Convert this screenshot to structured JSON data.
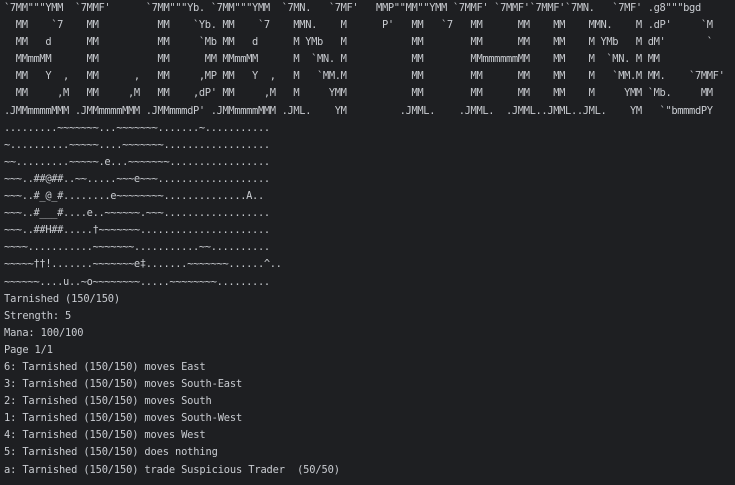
{
  "banner": [
    "`7MM\"\"\"YMM  `7MMF'      `7MM\"\"\"Yb. `7MM\"\"\"YMM  `7MN.   `7MF'   MMP\"\"MM\"\"YMM `7MMF' `7MMF'`7MMF'`7MN.   `7MF' .g8\"\"\"bgd",
    "  MM    `7    MM          MM    `Yb. MM    `7    MMN.    M      P'   MM   `7   MM      MM    MM    MMN.    M .dP'     `M",
    "  MM   d      MM          MM     `Mb MM   d      M YMb   M           MM        MM      MM    MM    M YMb   M dM'       `",
    "  MMmmMM      MM          MM      MM MMmmMM      M  `MN. M           MM        MMmmmmmmMM    MM    M  `MN. M MM",
    "  MM   Y  ,   MM      ,   MM     ,MP MM   Y  ,   M   `MM.M           MM        MM      MM    MM    M   `MM.M MM.    `7MMF'",
    "  MM     ,M   MM     ,M   MM    ,dP' MM     ,M   M     YMM           MM        MM      MM    MM    M     YMM `Mb.     MM",
    ".JMMmmmmMMM .JMMmmmmMMM .JMMmmmdP' .JMMmmmmMMM .JML.    YM         .JMML.    .JMML.  .JMML..JMML..JML.    YM   `\"bmmmdPY"
  ],
  "map": [
    ".........~~~~~~~...~~~~~~~.......~...........",
    "~..........~~~~~....~~~~~~~..................",
    "~~.........~~~~~.e...~~~~~~~.................",
    "~~~..##@##..~~.....~~~e~~~...................",
    "~~~..#_@_#........e~~~~~~~~..............A..",
    "~~~..#___#....e..~~~~~~.~~~..................",
    "~~~..##H##.....†~~~~~~~......................",
    "~~~~...........~~~~~~~...........~~..........",
    "~~~~~††!.......~~~~~~~e‡.......~~~~~~~......^..",
    "~~~~~~....u..~o~~~~~~~~.....~~~~~~~~........."
  ],
  "status": {
    "name_hp": "Tarnished (150/150)",
    "strength": "Strength: 5",
    "mana": "Mana: 100/100",
    "page": "Page 1/1"
  },
  "actions": [
    "6: Tarnished (150/150) moves East",
    "3: Tarnished (150/150) moves South-East",
    "2: Tarnished (150/150) moves South",
    "1: Tarnished (150/150) moves South-West",
    "4: Tarnished (150/150) moves West",
    "5: Tarnished (150/150) does nothing",
    "a: Tarnished (150/150) trade Suspicious Trader  (50/50)"
  ]
}
